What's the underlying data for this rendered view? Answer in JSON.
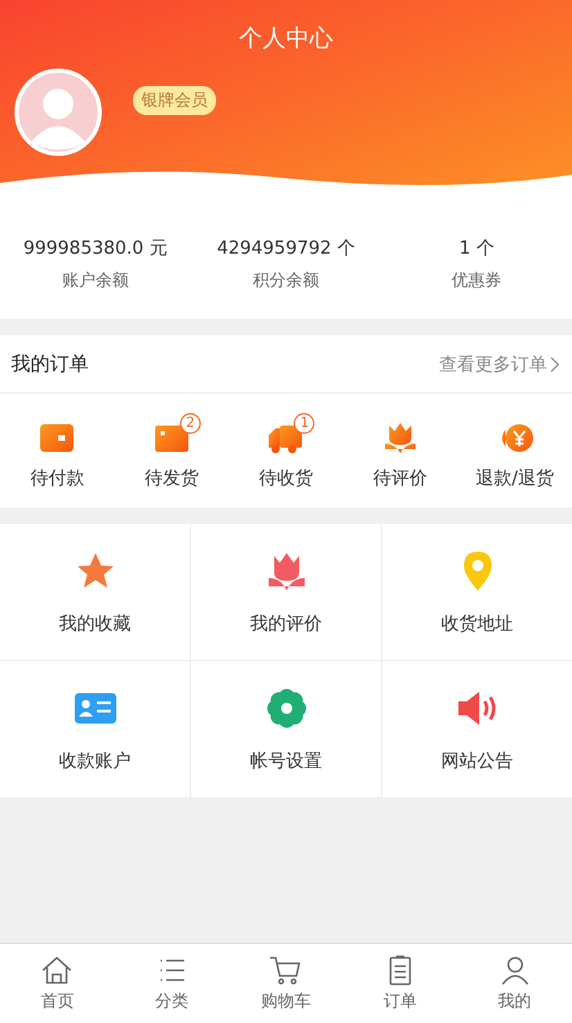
{
  "header": {
    "title": "个人中心",
    "member_badge": "银牌会员"
  },
  "stats": [
    {
      "value": "999985380.0 元",
      "label": "账户余额"
    },
    {
      "value": "4294959792 个",
      "label": "积分余额"
    },
    {
      "value": "1 个",
      "label": "优惠券"
    }
  ],
  "orders": {
    "title": "我的订单",
    "more": "查看更多订单",
    "items": [
      {
        "kind": "wallet",
        "label": "待付款"
      },
      {
        "kind": "box",
        "label": "待发货",
        "badge": "2"
      },
      {
        "kind": "truck",
        "label": "待收货",
        "badge": "1"
      },
      {
        "kind": "tulip",
        "label": "待评价"
      },
      {
        "kind": "refund",
        "label": "退款/退货"
      }
    ]
  },
  "services": [
    {
      "kind": "star",
      "label": "我的收藏",
      "color": "#f5793b"
    },
    {
      "kind": "tulip",
      "label": "我的评价",
      "color": "#f25b62"
    },
    {
      "kind": "pin",
      "label": "收货地址",
      "color": "#f9c70d"
    },
    {
      "kind": "card",
      "label": "收款账户",
      "color": "#2e9ff3"
    },
    {
      "kind": "gear",
      "label": "帐号设置",
      "color": "#1fae74"
    },
    {
      "kind": "speaker",
      "label": "网站公告",
      "color": "#ef4a4a"
    }
  ],
  "tabbar": [
    {
      "kind": "home",
      "label": "首页",
      "selected": false
    },
    {
      "kind": "list",
      "label": "分类",
      "selected": false
    },
    {
      "kind": "cart",
      "label": "购物车",
      "selected": false
    },
    {
      "kind": "doc",
      "label": "订单",
      "selected": false
    },
    {
      "kind": "user",
      "label": "我的",
      "selected": false
    }
  ]
}
